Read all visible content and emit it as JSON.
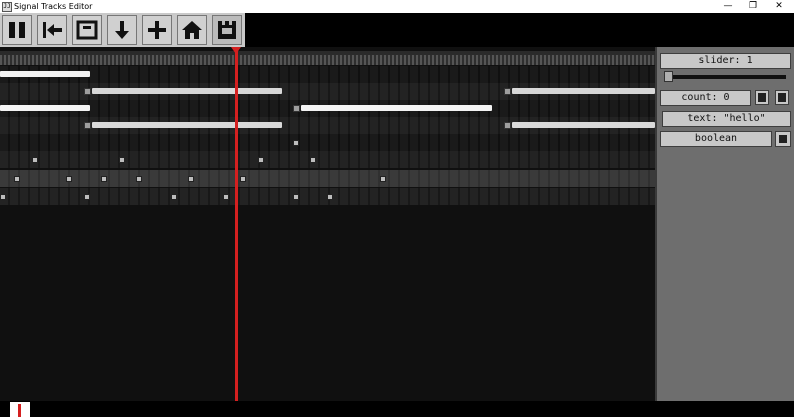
{
  "window": {
    "title": "Signal Tracks Editor",
    "app_icon_glyph": "JJ",
    "minimize_glyph": "—",
    "maximize_glyph": "❐",
    "close_glyph": "✕"
  },
  "toolbar": {
    "buttons": [
      {
        "icon": "pause-icon"
      },
      {
        "icon": "jump-to-start-icon"
      },
      {
        "icon": "frame-icon"
      },
      {
        "icon": "arrow-down-icon"
      },
      {
        "icon": "plus-icon"
      },
      {
        "icon": "home-icon"
      },
      {
        "icon": "castle-icon"
      }
    ]
  },
  "inspector": {
    "slider_label": "slider: 1",
    "slider_value": 1,
    "count_label": "count: 0",
    "text_label": "text: \"hello\"",
    "boolean_label": "boolean"
  },
  "colors": {
    "playhead": "#d42020",
    "timeline_bg": "#101010",
    "panel_bg": "#6e6e6e"
  }
}
